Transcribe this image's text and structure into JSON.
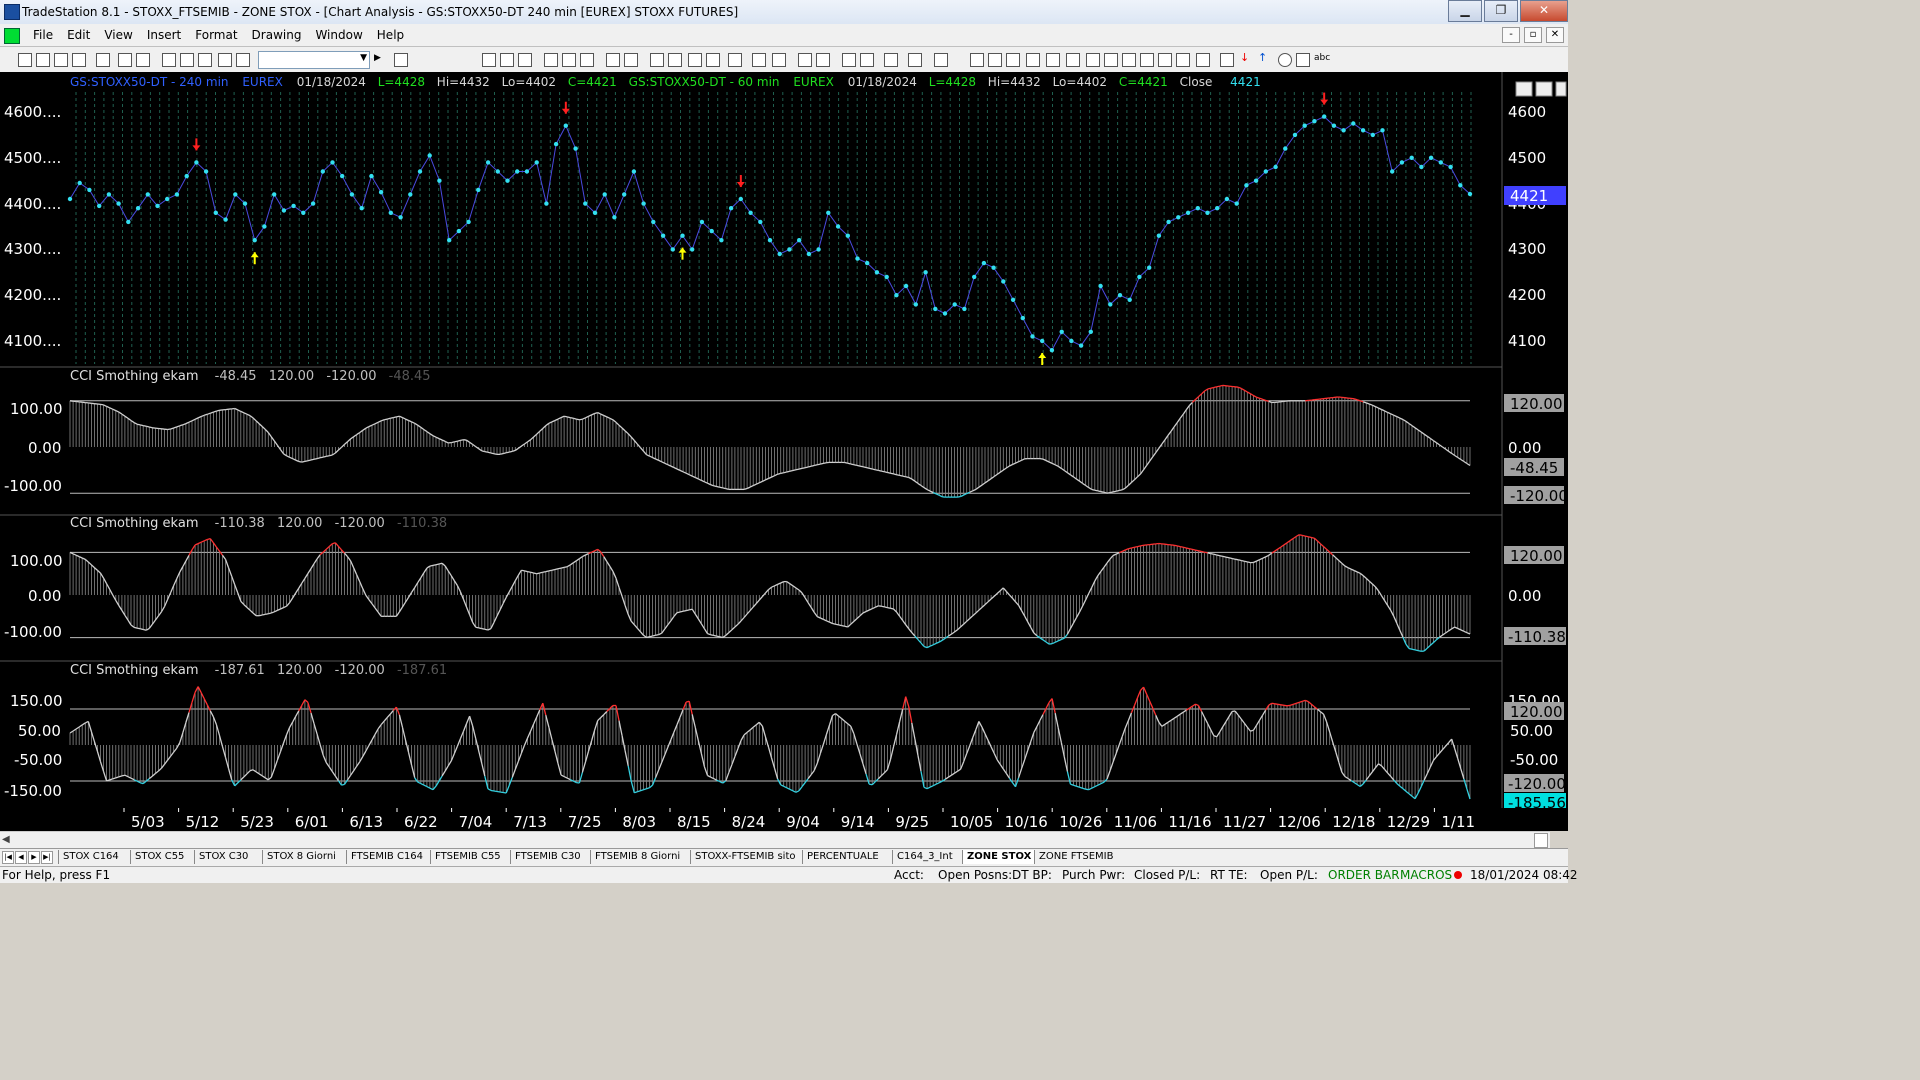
{
  "window": {
    "title": "TradeStation 8.1 - STOXX_FTSEMIB - ZONE STOX - [Chart Analysis - GS:STOXX50-DT  240 min  [EUREX] STOXX FUTURES]",
    "btn_min": "▁",
    "btn_max": "❐",
    "btn_close": "✕"
  },
  "menu": [
    "File",
    "Edit",
    "View",
    "Insert",
    "Format",
    "Drawing",
    "Window",
    "Help"
  ],
  "mdi_buttons": [
    "-",
    "▫",
    "✕"
  ],
  "header": {
    "sym1": "GS:STOXX50-DT - 240 min",
    "exch1": "EUREX",
    "date1": "01/18/2024",
    "l1": "L=4428",
    "h1": "Hi=4432",
    "lo1": "Lo=4402",
    "c1": "C=4421",
    "sym2": "GS:STOXX50-DT - 60 min",
    "exch2": "EUREX",
    "date2": "01/18/2024",
    "l2": "L=4428",
    "h2": "Hi=4432",
    "lo2": "Lo=4402",
    "c2": "C=4421",
    "close_label": "Close",
    "close_val": "4421"
  },
  "price_panel": {
    "ticks_left": [
      "4600....",
      "4500....",
      "4400....",
      "4300....",
      "4200....",
      "4100...."
    ],
    "ticks_right": [
      "4600",
      "4500",
      "4400",
      "4300",
      "4200",
      "4100"
    ],
    "last_badge": "4421"
  },
  "cci1": {
    "name": "CCI Smothing ekam",
    "v": "-48.45",
    "p1": "120.00",
    "p2": "-120.00",
    "v2": "-48.45",
    "ticks_left": [
      "100.00",
      "0.00",
      "-100.00"
    ],
    "badges": [
      "120.00",
      "0.00",
      "-48.45",
      "-120.00"
    ]
  },
  "cci2": {
    "name": "CCI Smothing ekam",
    "v": "-110.38",
    "p1": "120.00",
    "p2": "-120.00",
    "v2": "-110.38",
    "ticks_left": [
      "100.00",
      "0.00",
      "-100.00"
    ],
    "badges": [
      "120.00",
      "0.00",
      "-110.38"
    ]
  },
  "cci3": {
    "name": "CCI Smothing ekam",
    "v": "-187.61",
    "p1": "120.00",
    "p2": "-120.00",
    "v2": "-187.61",
    "ticks_left": [
      "150.00",
      "50.00",
      "-50.00",
      "-150.00"
    ],
    "badges": [
      "150.00",
      "120.00",
      "50.00",
      "-50.00",
      "-120.00",
      "-185.56"
    ]
  },
  "x_axis": [
    "5/03",
    "5/12",
    "5/23",
    "6/01",
    "6/13",
    "6/22",
    "7/04",
    "7/13",
    "7/25",
    "8/03",
    "8/15",
    "8/24",
    "9/04",
    "9/14",
    "9/25",
    "10/05",
    "10/16",
    "10/26",
    "11/06",
    "11/16",
    "11/27",
    "12/06",
    "12/18",
    "12/29",
    "1/11"
  ],
  "tabs": [
    "STOX C164",
    "STOX C55",
    "STOX  C30",
    "STOX  8 Giorni",
    "FTSEMIB C164",
    "FTSEMIB C55",
    "FTSEMIB C30",
    "FTSEMIB  8 Giorni",
    "STOXX-FTSEMIB sito",
    "PERCENTUALE",
    "C164_3_Int",
    "ZONE STOX",
    "ZONE FTSEMIB"
  ],
  "active_tab": "ZONE STOX",
  "status": {
    "help": "For Help, press F1",
    "acct": "Acct:",
    "open_posns": "Open Posns:",
    "dt_bp": "DT BP:",
    "purch_pwr": "Purch Pwr:",
    "closed_pl": "Closed P/L:",
    "rt_te": "RT TE:",
    "open_pl": "Open P/L:",
    "order_bar": "ORDER BAR",
    "macros": "MACROS",
    "datetime": "18/01/2024 08:42"
  },
  "colors": {
    "price": "#33e0f0",
    "up_arrow": "#ffff00",
    "down_arrow": "#ff2020",
    "cci_high": "#ff3030",
    "cci_low": "#33d0e0",
    "cci_mid": "#d0d0d0",
    "header_blue": "#3060ff",
    "header_green": "#20e020",
    "badge": "#a0a0a0",
    "last_badge": "#4040ff"
  },
  "chart_data": {
    "type": "line",
    "price_points": [
      4410,
      4445,
      4430,
      4395,
      4420,
      4400,
      4360,
      4390,
      4420,
      4395,
      4410,
      4420,
      4460,
      4490,
      4470,
      4380,
      4365,
      4420,
      4400,
      4320,
      4350,
      4420,
      4385,
      4395,
      4380,
      4400,
      4470,
      4490,
      4460,
      4420,
      4390,
      4460,
      4425,
      4380,
      4370,
      4420,
      4470,
      4505,
      4450,
      4320,
      4340,
      4360,
      4430,
      4490,
      4470,
      4450,
      4470,
      4470,
      4490,
      4400,
      4530,
      4570,
      4520,
      4400,
      4380,
      4420,
      4370,
      4420,
      4470,
      4400,
      4360,
      4330,
      4300,
      4330,
      4300,
      4360,
      4340,
      4320,
      4390,
      4410,
      4380,
      4360,
      4320,
      4290,
      4300,
      4320,
      4290,
      4300,
      4380,
      4350,
      4330,
      4280,
      4270,
      4250,
      4240,
      4200,
      4220,
      4180,
      4250,
      4170,
      4160,
      4180,
      4170,
      4240,
      4270,
      4260,
      4230,
      4190,
      4150,
      4110,
      4100,
      4080,
      4120,
      4100,
      4090,
      4120,
      4220,
      4180,
      4200,
      4190,
      4240,
      4260,
      4330,
      4360,
      4370,
      4380,
      4390,
      4380,
      4390,
      4410,
      4400,
      4440,
      4450,
      4470,
      4480,
      4520,
      4550,
      4570,
      4580,
      4590,
      4570,
      4560,
      4575,
      4560,
      4550,
      4560,
      4470,
      4490,
      4500,
      4480,
      4500,
      4490,
      4480,
      4440,
      4421
    ],
    "cci1": [
      120,
      115,
      110,
      90,
      60,
      50,
      45,
      60,
      80,
      95,
      100,
      80,
      40,
      -20,
      -40,
      -30,
      -20,
      20,
      50,
      70,
      80,
      60,
      30,
      10,
      20,
      -10,
      -20,
      -10,
      20,
      60,
      80,
      70,
      90,
      70,
      30,
      -20,
      -40,
      -60,
      -80,
      -100,
      -110,
      -110,
      -90,
      -70,
      -60,
      -50,
      -40,
      -40,
      -50,
      -60,
      -70,
      -80,
      -110,
      -130,
      -130,
      -110,
      -80,
      -50,
      -30,
      -30,
      -50,
      -80,
      -110,
      -120,
      -110,
      -70,
      -10,
      50,
      110,
      150,
      160,
      155,
      130,
      115,
      120,
      120,
      125,
      130,
      125,
      110,
      90,
      70,
      40,
      10,
      -20,
      -48
    ],
    "cci2": [
      120,
      100,
      60,
      -20,
      -90,
      -100,
      -40,
      60,
      140,
      160,
      100,
      -20,
      -60,
      -50,
      -30,
      40,
      110,
      150,
      100,
      0,
      -60,
      -60,
      10,
      80,
      90,
      20,
      -90,
      -100,
      -10,
      70,
      60,
      70,
      80,
      110,
      130,
      60,
      -70,
      -120,
      -110,
      -50,
      -40,
      -110,
      -120,
      -80,
      -30,
      20,
      40,
      10,
      -60,
      -80,
      -90,
      -50,
      -30,
      -40,
      -100,
      -150,
      -130,
      -100,
      -60,
      -20,
      20,
      -30,
      -110,
      -140,
      -120,
      -40,
      50,
      110,
      130,
      140,
      145,
      140,
      130,
      120,
      110,
      100,
      90,
      110,
      140,
      170,
      160,
      120,
      80,
      60,
      20,
      -50,
      -150,
      -160,
      -120,
      -90,
      -110
    ],
    "cci3": [
      40,
      80,
      -120,
      -100,
      -130,
      -80,
      0,
      200,
      80,
      -140,
      -80,
      -120,
      50,
      160,
      -50,
      -140,
      -50,
      60,
      130,
      -120,
      -150,
      -50,
      100,
      -150,
      -160,
      0,
      140,
      -100,
      -130,
      80,
      140,
      -160,
      -140,
      10,
      160,
      -100,
      -130,
      30,
      80,
      -130,
      -160,
      -80,
      110,
      60,
      -140,
      -80,
      170,
      -150,
      -120,
      -80,
      80,
      -50,
      -140,
      40,
      160,
      -130,
      -150,
      -120,
      50,
      200,
      60,
      100,
      140,
      20,
      120,
      40,
      140,
      130,
      150,
      100,
      -100,
      -140,
      -60,
      -130,
      -180,
      -50,
      20,
      -180
    ],
    "cci_levels": [
      120,
      -120
    ]
  }
}
